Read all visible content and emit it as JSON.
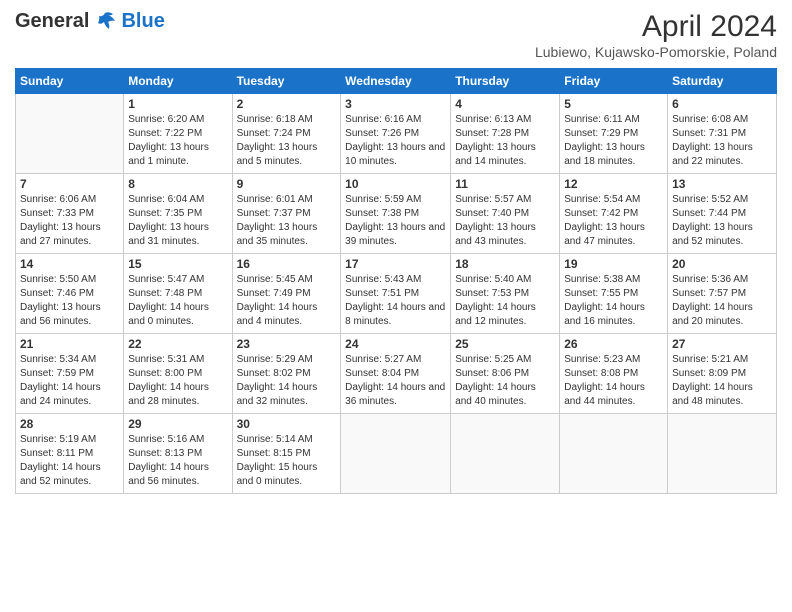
{
  "header": {
    "logo_general": "General",
    "logo_blue": "Blue",
    "month_title": "April 2024",
    "location": "Lubiewo, Kujawsko-Pomorskie, Poland"
  },
  "days_of_week": [
    "Sunday",
    "Monday",
    "Tuesday",
    "Wednesday",
    "Thursday",
    "Friday",
    "Saturday"
  ],
  "weeks": [
    [
      {
        "day": "",
        "sunrise": "",
        "sunset": "",
        "daylight": ""
      },
      {
        "day": "1",
        "sunrise": "Sunrise: 6:20 AM",
        "sunset": "Sunset: 7:22 PM",
        "daylight": "Daylight: 13 hours and 1 minute."
      },
      {
        "day": "2",
        "sunrise": "Sunrise: 6:18 AM",
        "sunset": "Sunset: 7:24 PM",
        "daylight": "Daylight: 13 hours and 5 minutes."
      },
      {
        "day": "3",
        "sunrise": "Sunrise: 6:16 AM",
        "sunset": "Sunset: 7:26 PM",
        "daylight": "Daylight: 13 hours and 10 minutes."
      },
      {
        "day": "4",
        "sunrise": "Sunrise: 6:13 AM",
        "sunset": "Sunset: 7:28 PM",
        "daylight": "Daylight: 13 hours and 14 minutes."
      },
      {
        "day": "5",
        "sunrise": "Sunrise: 6:11 AM",
        "sunset": "Sunset: 7:29 PM",
        "daylight": "Daylight: 13 hours and 18 minutes."
      },
      {
        "day": "6",
        "sunrise": "Sunrise: 6:08 AM",
        "sunset": "Sunset: 7:31 PM",
        "daylight": "Daylight: 13 hours and 22 minutes."
      }
    ],
    [
      {
        "day": "7",
        "sunrise": "Sunrise: 6:06 AM",
        "sunset": "Sunset: 7:33 PM",
        "daylight": "Daylight: 13 hours and 27 minutes."
      },
      {
        "day": "8",
        "sunrise": "Sunrise: 6:04 AM",
        "sunset": "Sunset: 7:35 PM",
        "daylight": "Daylight: 13 hours and 31 minutes."
      },
      {
        "day": "9",
        "sunrise": "Sunrise: 6:01 AM",
        "sunset": "Sunset: 7:37 PM",
        "daylight": "Daylight: 13 hours and 35 minutes."
      },
      {
        "day": "10",
        "sunrise": "Sunrise: 5:59 AM",
        "sunset": "Sunset: 7:38 PM",
        "daylight": "Daylight: 13 hours and 39 minutes."
      },
      {
        "day": "11",
        "sunrise": "Sunrise: 5:57 AM",
        "sunset": "Sunset: 7:40 PM",
        "daylight": "Daylight: 13 hours and 43 minutes."
      },
      {
        "day": "12",
        "sunrise": "Sunrise: 5:54 AM",
        "sunset": "Sunset: 7:42 PM",
        "daylight": "Daylight: 13 hours and 47 minutes."
      },
      {
        "day": "13",
        "sunrise": "Sunrise: 5:52 AM",
        "sunset": "Sunset: 7:44 PM",
        "daylight": "Daylight: 13 hours and 52 minutes."
      }
    ],
    [
      {
        "day": "14",
        "sunrise": "Sunrise: 5:50 AM",
        "sunset": "Sunset: 7:46 PM",
        "daylight": "Daylight: 13 hours and 56 minutes."
      },
      {
        "day": "15",
        "sunrise": "Sunrise: 5:47 AM",
        "sunset": "Sunset: 7:48 PM",
        "daylight": "Daylight: 14 hours and 0 minutes."
      },
      {
        "day": "16",
        "sunrise": "Sunrise: 5:45 AM",
        "sunset": "Sunset: 7:49 PM",
        "daylight": "Daylight: 14 hours and 4 minutes."
      },
      {
        "day": "17",
        "sunrise": "Sunrise: 5:43 AM",
        "sunset": "Sunset: 7:51 PM",
        "daylight": "Daylight: 14 hours and 8 minutes."
      },
      {
        "day": "18",
        "sunrise": "Sunrise: 5:40 AM",
        "sunset": "Sunset: 7:53 PM",
        "daylight": "Daylight: 14 hours and 12 minutes."
      },
      {
        "day": "19",
        "sunrise": "Sunrise: 5:38 AM",
        "sunset": "Sunset: 7:55 PM",
        "daylight": "Daylight: 14 hours and 16 minutes."
      },
      {
        "day": "20",
        "sunrise": "Sunrise: 5:36 AM",
        "sunset": "Sunset: 7:57 PM",
        "daylight": "Daylight: 14 hours and 20 minutes."
      }
    ],
    [
      {
        "day": "21",
        "sunrise": "Sunrise: 5:34 AM",
        "sunset": "Sunset: 7:59 PM",
        "daylight": "Daylight: 14 hours and 24 minutes."
      },
      {
        "day": "22",
        "sunrise": "Sunrise: 5:31 AM",
        "sunset": "Sunset: 8:00 PM",
        "daylight": "Daylight: 14 hours and 28 minutes."
      },
      {
        "day": "23",
        "sunrise": "Sunrise: 5:29 AM",
        "sunset": "Sunset: 8:02 PM",
        "daylight": "Daylight: 14 hours and 32 minutes."
      },
      {
        "day": "24",
        "sunrise": "Sunrise: 5:27 AM",
        "sunset": "Sunset: 8:04 PM",
        "daylight": "Daylight: 14 hours and 36 minutes."
      },
      {
        "day": "25",
        "sunrise": "Sunrise: 5:25 AM",
        "sunset": "Sunset: 8:06 PM",
        "daylight": "Daylight: 14 hours and 40 minutes."
      },
      {
        "day": "26",
        "sunrise": "Sunrise: 5:23 AM",
        "sunset": "Sunset: 8:08 PM",
        "daylight": "Daylight: 14 hours and 44 minutes."
      },
      {
        "day": "27",
        "sunrise": "Sunrise: 5:21 AM",
        "sunset": "Sunset: 8:09 PM",
        "daylight": "Daylight: 14 hours and 48 minutes."
      }
    ],
    [
      {
        "day": "28",
        "sunrise": "Sunrise: 5:19 AM",
        "sunset": "Sunset: 8:11 PM",
        "daylight": "Daylight: 14 hours and 52 minutes."
      },
      {
        "day": "29",
        "sunrise": "Sunrise: 5:16 AM",
        "sunset": "Sunset: 8:13 PM",
        "daylight": "Daylight: 14 hours and 56 minutes."
      },
      {
        "day": "30",
        "sunrise": "Sunrise: 5:14 AM",
        "sunset": "Sunset: 8:15 PM",
        "daylight": "Daylight: 15 hours and 0 minutes."
      },
      {
        "day": "",
        "sunrise": "",
        "sunset": "",
        "daylight": ""
      },
      {
        "day": "",
        "sunrise": "",
        "sunset": "",
        "daylight": ""
      },
      {
        "day": "",
        "sunrise": "",
        "sunset": "",
        "daylight": ""
      },
      {
        "day": "",
        "sunrise": "",
        "sunset": "",
        "daylight": ""
      }
    ]
  ]
}
